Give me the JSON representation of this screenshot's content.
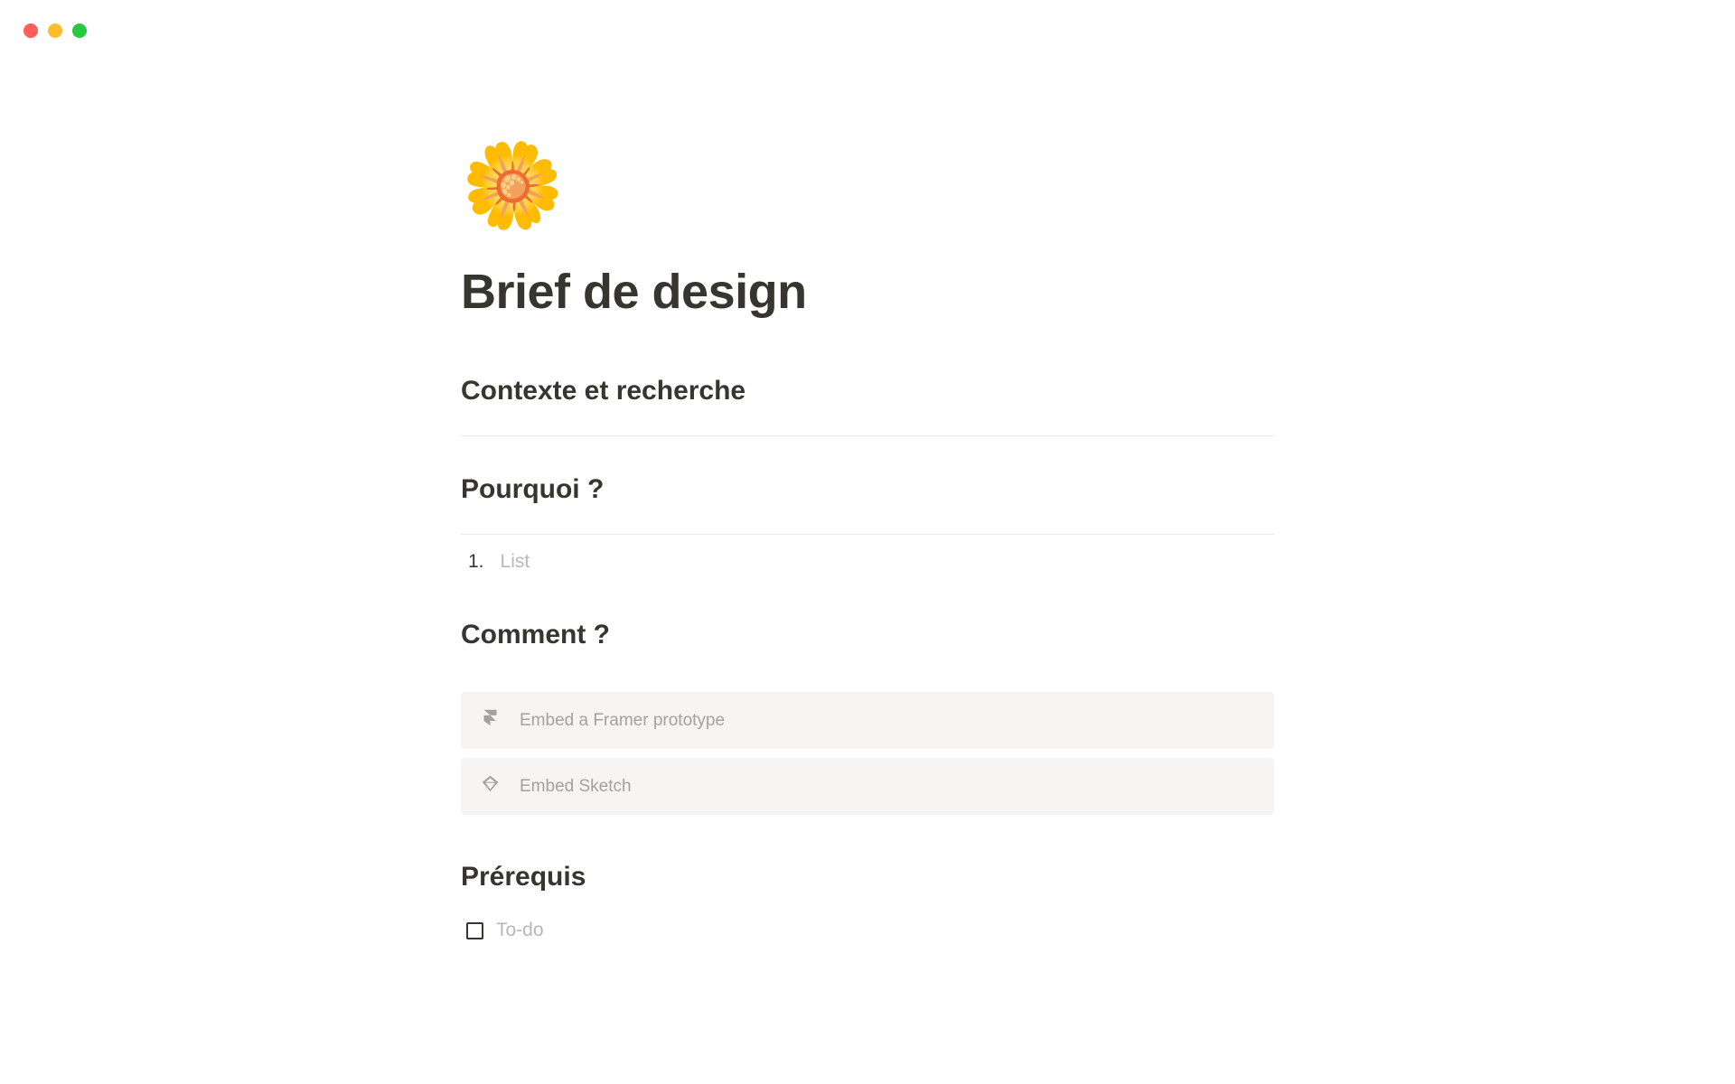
{
  "page": {
    "icon": "🌼",
    "title": "Brief de design"
  },
  "sections": {
    "contexte": {
      "heading": "Contexte et recherche"
    },
    "pourquoi": {
      "heading": "Pourquoi ?",
      "list_number": "1.",
      "list_placeholder": "List"
    },
    "comment": {
      "heading": "Comment ?"
    },
    "prerequis": {
      "heading": "Prérequis",
      "todo_placeholder": "To-do"
    }
  },
  "embeds": {
    "framer": {
      "label": "Embed a Framer prototype"
    },
    "sketch": {
      "label": "Embed Sketch"
    }
  }
}
